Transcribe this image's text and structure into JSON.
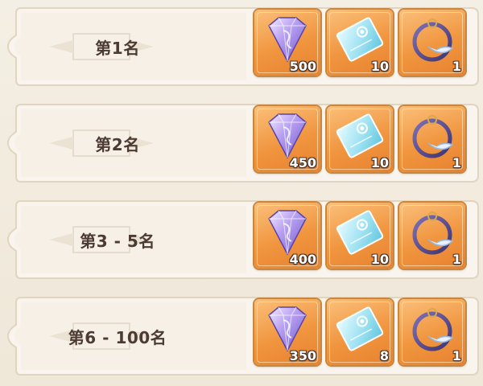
{
  "rewards": [
    {
      "rank": "第1名",
      "items": [
        {
          "icon": "gem-icon",
          "qty": "500"
        },
        {
          "icon": "ticket-icon",
          "qty": "10"
        },
        {
          "icon": "bracelet-icon",
          "qty": "1"
        }
      ]
    },
    {
      "rank": "第2名",
      "items": [
        {
          "icon": "gem-icon",
          "qty": "450"
        },
        {
          "icon": "ticket-icon",
          "qty": "10"
        },
        {
          "icon": "bracelet-icon",
          "qty": "1"
        }
      ]
    },
    {
      "rank": "第3 - 5名",
      "items": [
        {
          "icon": "gem-icon",
          "qty": "400"
        },
        {
          "icon": "ticket-icon",
          "qty": "10"
        },
        {
          "icon": "bracelet-icon",
          "qty": "1"
        }
      ]
    },
    {
      "rank": "第6 - 100名",
      "items": [
        {
          "icon": "gem-icon",
          "qty": "350"
        },
        {
          "icon": "ticket-icon",
          "qty": "8"
        },
        {
          "icon": "bracelet-icon",
          "qty": "1"
        }
      ]
    }
  ],
  "colors": {
    "item_bg": "#f0953f",
    "rank_text": "#4b3b33",
    "row_bg": "#f8f3ea",
    "row_border": "#e2d6c2"
  }
}
